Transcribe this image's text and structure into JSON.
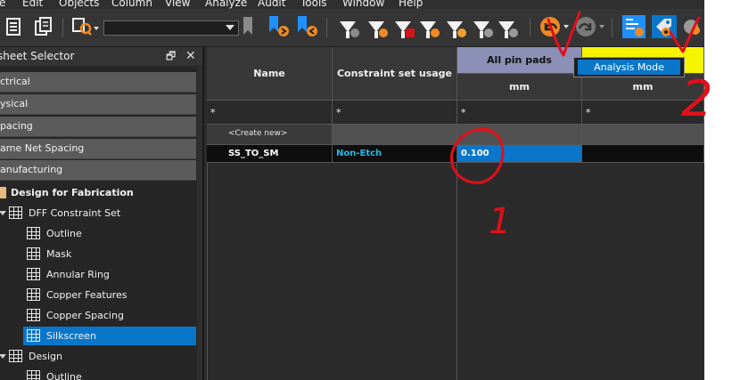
{
  "menu": [
    "e",
    "Edit",
    "Objects",
    "Column",
    "View",
    "Analyze",
    "Audit",
    "Tools",
    "Window",
    "Help"
  ],
  "toolbar": {
    "combo_value": "",
    "accent_orange": "#f08a24",
    "accent_blue": "#1e90ff"
  },
  "panel": {
    "title": "sheet Selector",
    "pin_glyph": "🗗",
    "close_glyph": "✕",
    "categories": [
      "ctrical",
      "ysical",
      "pacing",
      "ame Net Spacing",
      "anufacturing"
    ],
    "tree": {
      "root": "Design for Fabrication",
      "set1": "DFF Constraint Set",
      "items": [
        "Outline",
        "Mask",
        "Annular Ring",
        "Copper Features",
        "Copper Spacing",
        "Silkscreen"
      ],
      "selected": "Silkscreen",
      "set2": "Design",
      "set2_items": [
        "Outline"
      ]
    }
  },
  "grid": {
    "col_name": "Name",
    "col_csu": "Constraint set usage",
    "col_pads": "All pin pads",
    "col_yellow": "",
    "unit_pads": "mm",
    "unit_yellow": "mm",
    "filter_name": "*",
    "filter_csu": "*",
    "filter_pads": "*",
    "filter_yellow": "*",
    "create_new": "<Create new>",
    "rows": [
      {
        "name": "SS_TO_SM",
        "csu": "Non-Etch",
        "value": "0.100"
      }
    ]
  },
  "popup": {
    "item": "Analysis Mode"
  },
  "annotations": {
    "number_1": "1",
    "number_2": "2",
    "color": "#e0101a"
  }
}
